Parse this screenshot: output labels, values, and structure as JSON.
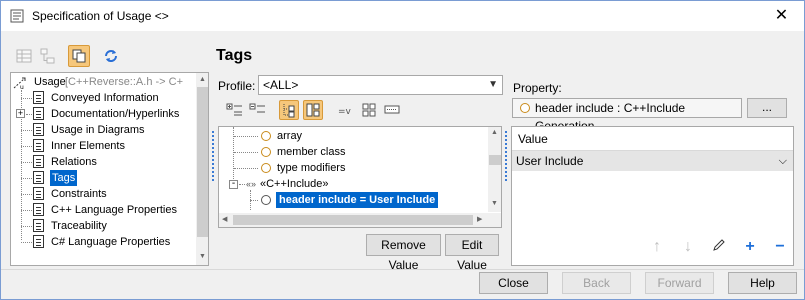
{
  "window": {
    "title": "Specification of Usage <>",
    "close_glyph": "✕"
  },
  "toolbar": {
    "icons": [
      "table-view-icon",
      "hierarchy-view-icon",
      "show-all-icon",
      "refresh-icon"
    ]
  },
  "tree": {
    "root_label": "Usage",
    "root_detail": "[C++Reverse::A.h -> C+",
    "items": [
      "Conveyed Information",
      "Documentation/Hyperlinks",
      "Usage in Diagrams",
      "Inner Elements",
      "Relations",
      "Tags",
      "Constraints",
      "C++ Language Properties",
      "Traceability",
      "C# Language Properties"
    ],
    "selected_item": "Tags"
  },
  "panel": {
    "title": "Tags",
    "profile_label": "Profile:",
    "profile_value": "<ALL>",
    "property_label": "Property:",
    "property_value": "header include : C++Include Generation",
    "browse_label": "..."
  },
  "tags": {
    "rows": [
      {
        "label": "array"
      },
      {
        "label": "member class"
      },
      {
        "label": "type modifiers"
      }
    ],
    "group_label": "«C++Include»",
    "selected_row": "header include = User Include"
  },
  "buttons": {
    "remove_value": "Remove Value",
    "edit_value": "Edit Value",
    "close": "Close",
    "back": "Back",
    "forward": "Forward",
    "help": "Help"
  },
  "value_panel": {
    "header": "Value",
    "current_value": "User Include"
  },
  "colors": {
    "selection": "#0066cc",
    "active_toggle": "#f6c77b",
    "stereotype_ring": "#c98b1b"
  }
}
